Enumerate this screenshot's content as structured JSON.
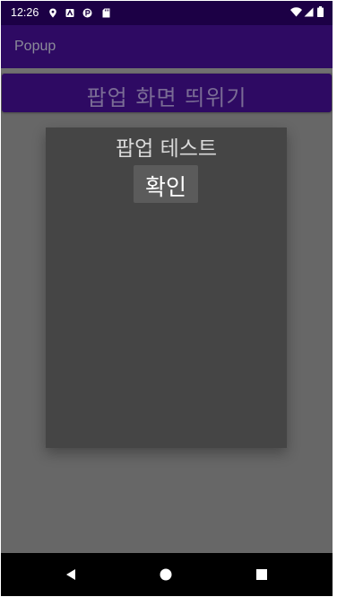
{
  "status_bar": {
    "time": "12:26",
    "left_icons": [
      "location-icon",
      "android-notification-icon",
      "circle-p-icon",
      "sd-card-icon"
    ],
    "right_icons": [
      "wifi-icon",
      "cellular-signal-icon",
      "battery-icon"
    ],
    "color": "#ffffff"
  },
  "app_bar": {
    "title": "Popup",
    "background": "#2e0a63"
  },
  "main": {
    "show_popup_button_label": "팝업 화면 띄위기"
  },
  "popup": {
    "title": "팝업 테스트",
    "confirm_label": "확인",
    "background": "#454545"
  },
  "nav_bar": {
    "buttons": [
      "back-icon",
      "home-icon",
      "recents-icon"
    ]
  }
}
